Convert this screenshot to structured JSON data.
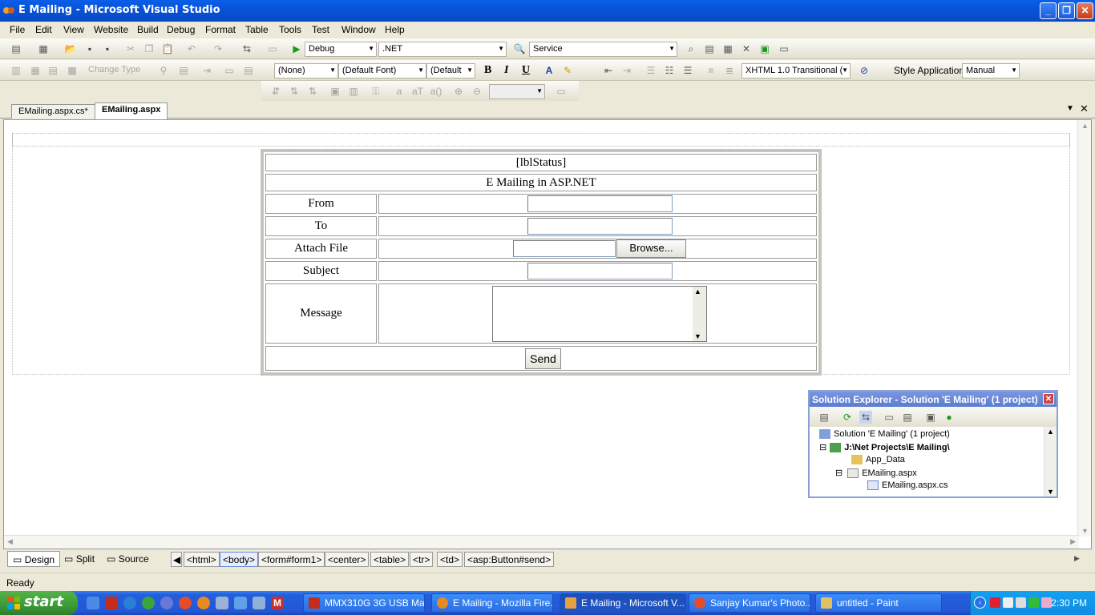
{
  "window": {
    "title": "E Mailing - Microsoft Visual Studio"
  },
  "menu": [
    "File",
    "Edit",
    "View",
    "Website",
    "Build",
    "Debug",
    "Format",
    "Table",
    "Tools",
    "Test",
    "Window",
    "Help"
  ],
  "toolbar1": {
    "config": "Debug",
    "platform": ".NET",
    "find": "Service"
  },
  "toolbar2": {
    "change_type": "Change Type",
    "block_format": "(None)",
    "font": "(Default Font)",
    "size": "(Default",
    "bold": "B",
    "italic": "I",
    "underline": "U",
    "doctype": "XHTML 1.0 Transitional (",
    "style_app_label": "Style Application:",
    "style_app_value": "Manual"
  },
  "tabs": [
    {
      "label": "EMailing.aspx.cs*"
    },
    {
      "label": "EMailing.aspx"
    }
  ],
  "form": {
    "status": "[lblStatus]",
    "heading": "E Mailing in ASP.NET",
    "from_label": "From",
    "to_label": "To",
    "attach_label": "Attach File",
    "browse_label": "Browse...",
    "subject_label": "Subject",
    "message_label": "Message",
    "send_label": "Send"
  },
  "solution_explorer": {
    "title": "Solution Explorer - Solution 'E Mailing' (1 project)",
    "items": [
      "Solution 'E Mailing' (1 project)",
      "J:\\Net Projects\\E Mailing\\",
      "App_Data",
      "EMailing.aspx",
      "EMailing.aspx.cs"
    ]
  },
  "view_tabs": [
    "Design",
    "Split",
    "Source"
  ],
  "breadcrumb": [
    "<html>",
    "<body>",
    "<form#form1>",
    "<center>",
    "<table>",
    "<tr>",
    "<td>",
    "<asp:Button#send>"
  ],
  "status": "Ready",
  "taskbar": {
    "start": "start",
    "tasks": [
      "MMX310G 3G USB Ma...",
      "E Mailing - Mozilla Fire...",
      "E Mailing - Microsoft V...",
      "Sanjay Kumar's Photo...",
      "untitled - Paint"
    ],
    "clock": "2:30 PM"
  }
}
